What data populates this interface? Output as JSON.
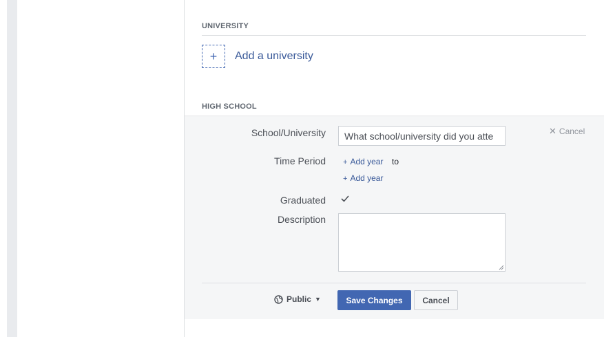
{
  "university": {
    "heading": "UNIVERSITY",
    "add_icon": "plus-icon",
    "add_label": "Add a university"
  },
  "high_school": {
    "heading": "HIGH SCHOOL",
    "school_label": "School/University",
    "school_placeholder": "What school/university did you atte",
    "cancel_link": "Cancel",
    "time_period_label": "Time Period",
    "add_year_start": "Add year",
    "to_text": "to",
    "add_year_end": "Add year",
    "graduated_label": "Graduated",
    "graduated_checked": true,
    "description_label": "Description",
    "description_value": ""
  },
  "footer": {
    "privacy_icon": "globe-icon",
    "privacy_label": "Public",
    "save_label": "Save Changes",
    "cancel_label": "Cancel"
  },
  "colors": {
    "accent": "#4267b2",
    "link": "#385898",
    "form_bg": "#f5f6f7"
  }
}
